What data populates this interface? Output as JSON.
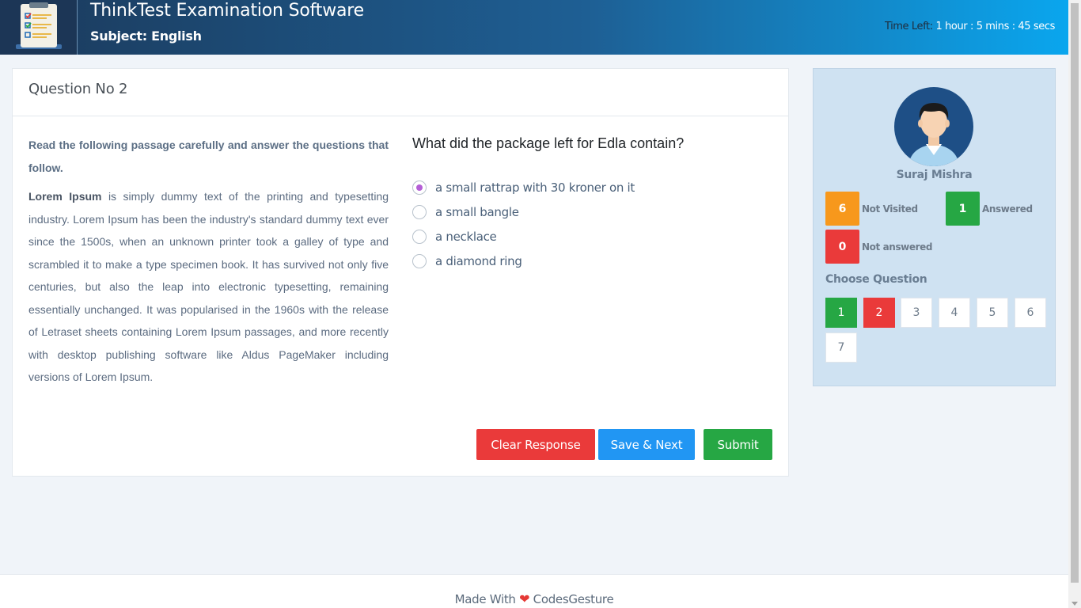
{
  "header": {
    "title": "ThinkTest Examination Software",
    "subject": "Subject: English",
    "time_label": "Time Left:",
    "time_value": "1 hour : 5 mins : 45 secs"
  },
  "question": {
    "number_label": "Question No 2",
    "passage_heading": "Read the following passage carefully and answer the questions that follow.",
    "passage_bold": "Lorem Ipsum",
    "passage_text": " is simply dummy text of the printing and typesetting industry. Lorem Ipsum has been the industry's standard dummy text ever since the 1500s, when an unknown printer took a galley of type and scrambled it to make a type specimen book. It has survived not only five centuries, but also the leap into electronic typesetting, remaining essentially unchanged. It was popularised in the 1960s with the release of Letraset sheets containing Lorem Ipsum passages, and more recently with desktop publishing software like Aldus PageMaker including versions of Lorem Ipsum.",
    "text": "What did the package left for Edla contain?",
    "options": [
      "a small rattrap with 30 kroner on it",
      "a small bangle",
      "a necklace",
      "a diamond ring"
    ],
    "selected_option": 0
  },
  "buttons": {
    "clear": "Clear Response",
    "save_next": "Save & Next",
    "submit": "Submit"
  },
  "sidebar": {
    "user_name": "Suraj Mishra",
    "stats": {
      "not_visited": {
        "count": "6",
        "label": "Not Visited"
      },
      "answered": {
        "count": "1",
        "label": "Answered"
      },
      "not_answered": {
        "count": "0",
        "label": "Not answered"
      }
    },
    "choose_label": "Choose Question",
    "questions": [
      "1",
      "2",
      "3",
      "4",
      "5",
      "6",
      "7"
    ]
  },
  "footer": {
    "made_with": "Made With",
    "brand": "CodesGesture"
  },
  "colors": {
    "answered": "#26a744",
    "current": "#ea3a3a",
    "not_visited": "#f7981c",
    "primary": "#2196f3",
    "selected_radio": "#b45ed6"
  }
}
